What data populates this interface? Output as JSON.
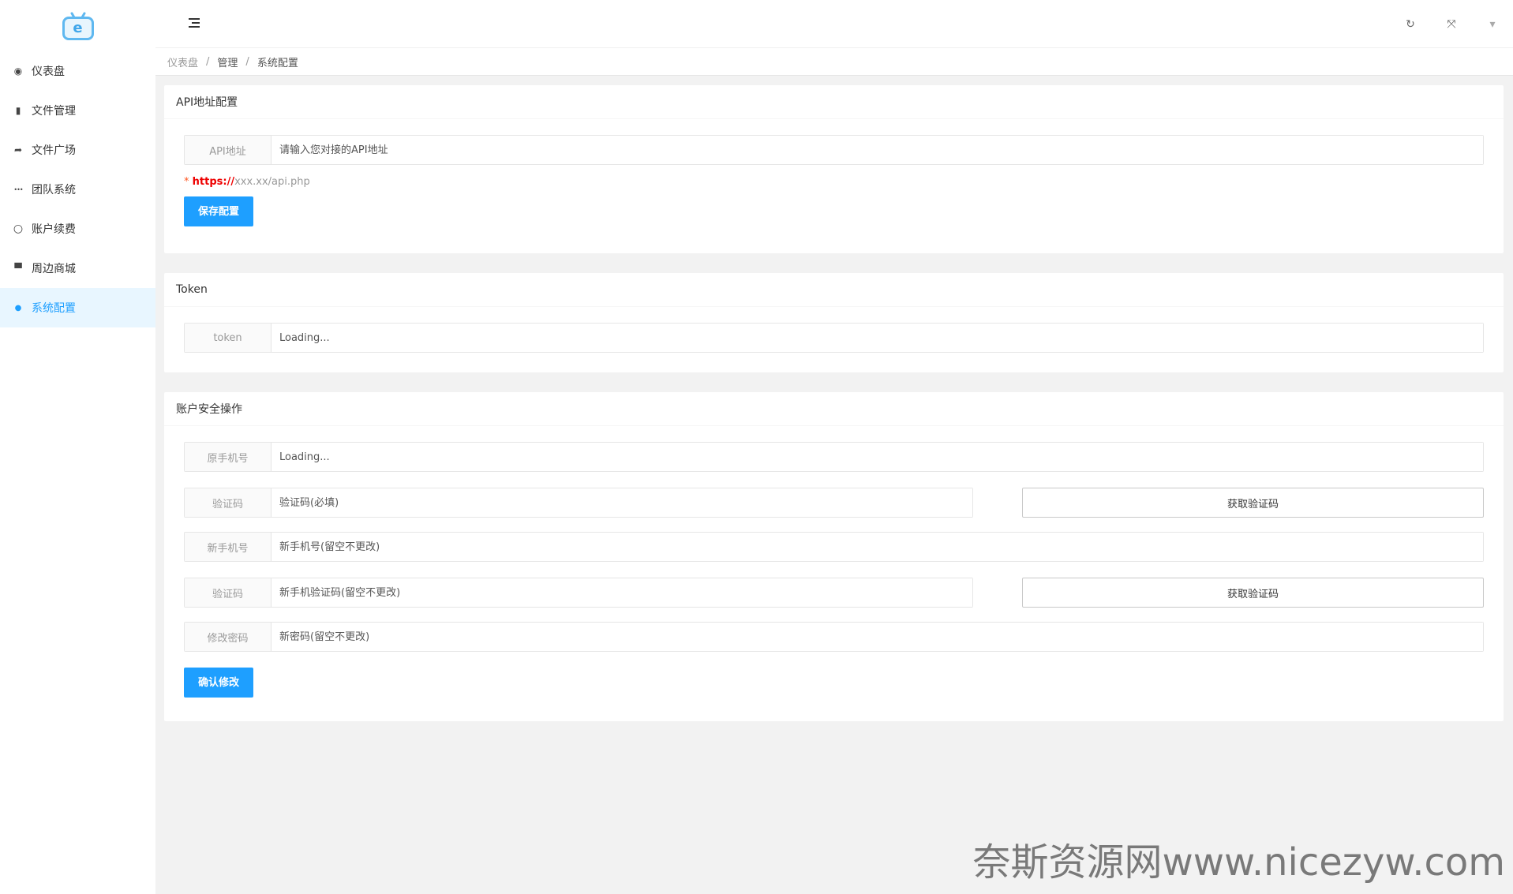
{
  "sidebar": {
    "logo_icon": "tv-e-logo-icon",
    "logo_letter": "e",
    "items": [
      {
        "label": "仪表盘",
        "icon": "dashboard-icon",
        "glyph": "◉"
      },
      {
        "label": "文件管理",
        "icon": "file-icon",
        "glyph": "▮"
      },
      {
        "label": "文件广场",
        "icon": "share-icon",
        "glyph": "➦"
      },
      {
        "label": "团队系统",
        "icon": "ellipsis-icon",
        "glyph": "•••"
      },
      {
        "label": "账户续费",
        "icon": "circle-icon",
        "glyph": "○"
      },
      {
        "label": "周边商城",
        "icon": "cart-icon",
        "glyph": "▀"
      },
      {
        "label": "系统配置",
        "icon": "user-icon",
        "glyph": "●",
        "active": true
      }
    ]
  },
  "header": {
    "menu_icon": "menu-toggle-icon",
    "refresh_glyph": "↻",
    "fullscreen_glyph": "⤧",
    "dropdown_glyph": "▾"
  },
  "breadcrumb": [
    "仪表盘",
    "管理",
    "系统配置"
  ],
  "api_card": {
    "title": "API地址配置",
    "field_label": "API地址",
    "field_placeholder": "请输入您对接的API地址",
    "hint_star": "*",
    "hint_https": "https://",
    "hint_rest": "xxx.xx/api.php",
    "save_button": "保存配置"
  },
  "token_card": {
    "title": "Token",
    "field_label": "token",
    "field_placeholder": "Loading..."
  },
  "security_card": {
    "title": "账户安全操作",
    "old_phone_label": "原手机号",
    "old_phone_placeholder": "Loading...",
    "code1_label": "验证码",
    "code1_placeholder": "验证码(必填)",
    "get_code1": "获取验证码",
    "new_phone_label": "新手机号",
    "new_phone_placeholder": "新手机号(留空不更改)",
    "code2_label": "验证码",
    "code2_placeholder": "新手机验证码(留空不更改)",
    "get_code2": "获取验证码",
    "password_label": "修改密码",
    "password_placeholder": "新密码(留空不更改)",
    "confirm_button": "确认修改"
  },
  "watermark": "奈斯资源网www.nicezyw.com",
  "colors": {
    "primary": "#1e9fff",
    "active_bg": "#e8f6ff",
    "https_red": "#e00000"
  }
}
